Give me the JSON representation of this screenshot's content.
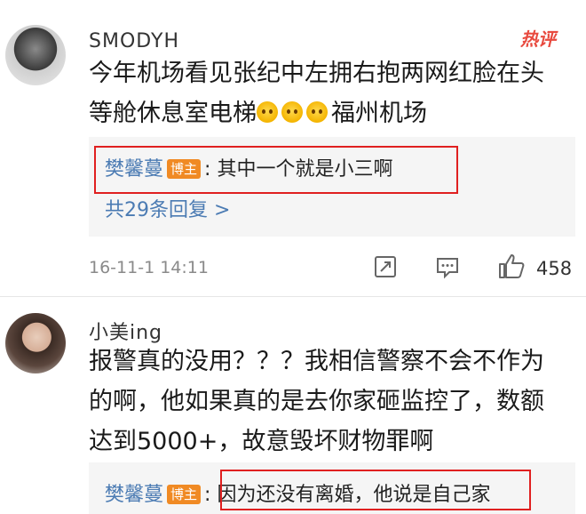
{
  "comments": [
    {
      "username": "SMODYH",
      "hot_label": "热评",
      "text_line1": "今年机场看见张纪中左拥右抱两网红脸在头",
      "text_line2_before": "等舱休息室电梯",
      "text_line2_after": "福州机场",
      "reply": {
        "name": "樊馨蔓",
        "badge": "博主",
        "colon": ":",
        "text": "其中一个就是小三啊"
      },
      "reply_count": "共29条回复 >",
      "time": "16-11-1 14:11",
      "likes": "458"
    },
    {
      "username": "小美ing",
      "text_line1": "报警真的没用？？？我相信警察不会不作为",
      "text_line2": "的啊，他如果真的是去你家砸监控了，数额",
      "text_line3": "达到5000+，故意毁坏财物罪啊",
      "reply": {
        "name": "樊馨蔓",
        "badge": "博主",
        "colon": ":",
        "text": "因为还没有离婚，他说是自己家"
      }
    }
  ],
  "icons": [
    "share-icon",
    "comment-icon",
    "like-icon",
    "emoji-icon"
  ],
  "colors": {
    "link": "#4b7bb3",
    "badge": "#f08a24",
    "highlight_box": "#e02020",
    "hot": "#e84a3f"
  }
}
